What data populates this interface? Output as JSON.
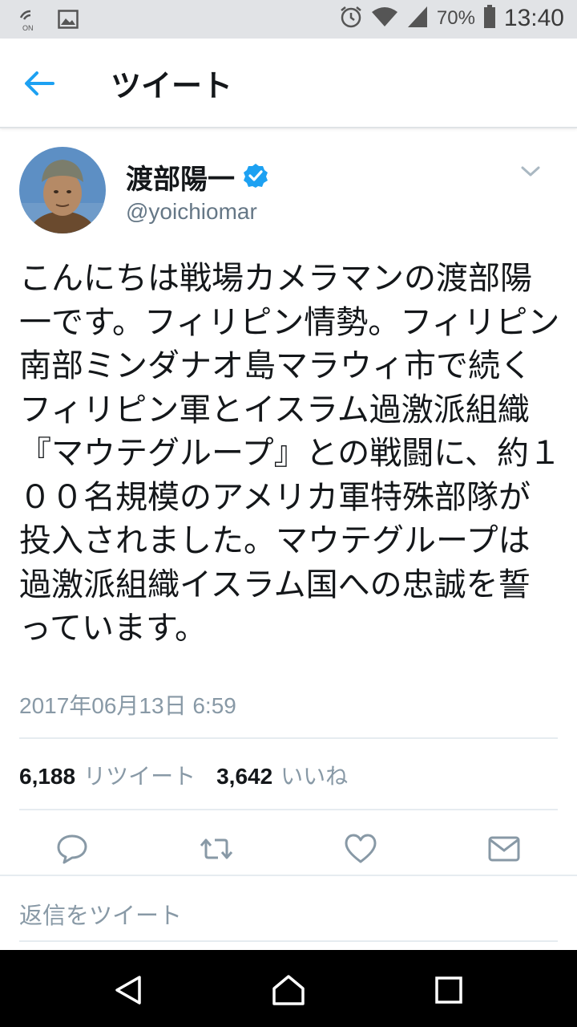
{
  "status_bar": {
    "battery": "70%",
    "time": "13:40",
    "icons": [
      "nfc-icon",
      "image-icon",
      "alarm-icon",
      "wifi-icon",
      "signal-icon",
      "battery-icon"
    ]
  },
  "app_bar": {
    "title": "ツイート",
    "back_icon": "back-arrow-icon"
  },
  "tweet": {
    "display_name": "渡部陽一",
    "verified": true,
    "handle": "@yoichiomar",
    "text": "こんにちは戦場カメラマンの渡部陽一です。フィリピン情勢。フィリピン南部ミンダナオ島マラウィ市で続くフィリピン軍とイスラム過激派組織『マウテグループ』との戦闘に、約１００名規模のアメリカ軍特殊部隊が投入されました。マウテグループは過激派組織イスラム国への忠誠を誓っています。",
    "timestamp": "2017年06月13日 6:59",
    "retweet_count": "6,188",
    "retweet_label": "リツイート",
    "like_count": "3,642",
    "like_label": "いいね"
  },
  "actions": [
    "reply-icon",
    "retweet-icon",
    "like-icon",
    "direct-message-icon"
  ],
  "reply_prompt": "返信をツイート",
  "colors": {
    "accent": "#1da1f2",
    "secondary_text": "#8899a6",
    "status_bar_bg": "#e1e3e6",
    "nav_bar_bg": "#000000"
  }
}
